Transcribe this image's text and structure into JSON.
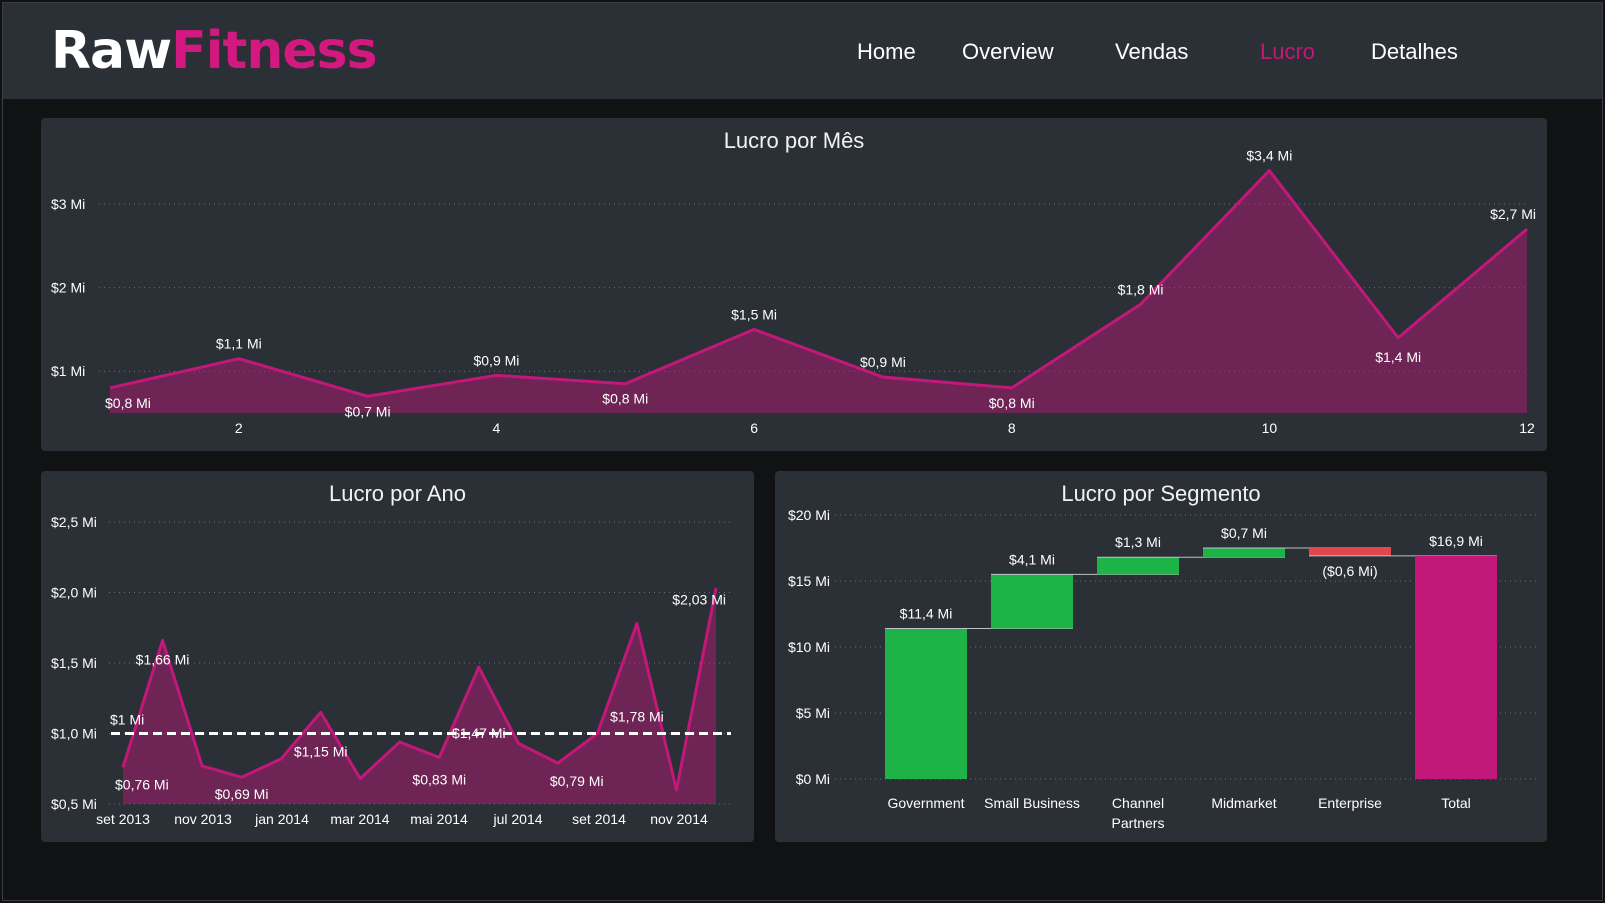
{
  "app": {
    "logo_part1": "Raw",
    "logo_part2": "Fitness",
    "colors": {
      "brand": "#d3187f",
      "increase": "#1db346",
      "decrease": "#e0474c",
      "total": "#c2187a",
      "panel": "#2b2f36",
      "background": "#111214"
    }
  },
  "nav": {
    "items": [
      {
        "label": "Home",
        "active": false
      },
      {
        "label": "Overview",
        "active": false
      },
      {
        "label": "Vendas",
        "active": false
      },
      {
        "label": "Lucro",
        "active": true
      },
      {
        "label": "Detalhes",
        "active": false
      }
    ]
  },
  "chart_data": [
    {
      "id": "monthly",
      "type": "area",
      "title": "Lucro por Mês",
      "x": [
        1,
        2,
        3,
        4,
        5,
        6,
        7,
        8,
        9,
        10,
        11,
        12
      ],
      "values": [
        0.8,
        1.15,
        0.7,
        0.95,
        0.85,
        1.5,
        0.93,
        0.8,
        1.8,
        3.4,
        1.4,
        2.7
      ],
      "labels": [
        "$0,8 Mi",
        "$1,1 Mi",
        "$0,7 Mi",
        "$0,9 Mi",
        "$0,8 Mi",
        "$1,5 Mi",
        "$0,9 Mi",
        "$0,8 Mi",
        "$1,8 Mi",
        "$3,4 Mi",
        "$1,4 Mi",
        "$2,7 Mi"
      ],
      "x_ticks": [
        "2",
        "4",
        "6",
        "8",
        "10",
        "12"
      ],
      "y_ticks": [
        "$1 Mi",
        "$2 Mi",
        "$3 Mi"
      ],
      "ylim": [
        0.5,
        3.5
      ],
      "grid": true,
      "color": "#c2187a"
    },
    {
      "id": "yearly",
      "type": "area",
      "title": "Lucro por Ano",
      "values": [
        0.76,
        1.66,
        0.77,
        0.69,
        0.82,
        1.15,
        0.68,
        0.94,
        0.83,
        1.47,
        0.93,
        0.79,
        1.0,
        1.78,
        0.6,
        2.03
      ],
      "point_labels": [
        {
          "index": 0,
          "text": "$0,76 Mi"
        },
        {
          "index": 1,
          "text": "$1,66 Mi"
        },
        {
          "index": 3,
          "text": "$0,69 Mi"
        },
        {
          "index": 5,
          "text": "$1,15 Mi"
        },
        {
          "index": 8,
          "text": "$0,83 Mi"
        },
        {
          "index": 9,
          "text": "$1,47 Mi"
        },
        {
          "index": 11,
          "text": "$0,79 Mi"
        },
        {
          "index": 13,
          "text": "$1,78 Mi"
        },
        {
          "index": 15,
          "text": "$2,03 Mi"
        }
      ],
      "x_ticks": [
        "set 2013",
        "nov 2013",
        "jan 2014",
        "mar 2014",
        "mai 2014",
        "jul 2014",
        "set 2014",
        "nov 2014"
      ],
      "y_ticks": [
        "$0,5 Mi",
        "$1,0 Mi",
        "$1,5 Mi",
        "$2,0 Mi",
        "$2,5 Mi"
      ],
      "ylim": [
        0.5,
        2.5
      ],
      "reference_line": {
        "value": 1.0,
        "label": "$1 Mi"
      },
      "grid": true,
      "color": "#c2187a"
    },
    {
      "id": "segment",
      "type": "bar",
      "subtype": "waterfall",
      "title": "Lucro por Segmento",
      "categories": [
        "Government",
        "Small Business",
        "Channel Partners",
        "Midmarket",
        "Enterprise",
        "Total"
      ],
      "category_lines": [
        [
          "Government"
        ],
        [
          "Small Business"
        ],
        [
          "Channel",
          "Partners"
        ],
        [
          "Midmarket"
        ],
        [
          "Enterprise"
        ],
        [
          "Total"
        ]
      ],
      "values": [
        11.4,
        4.1,
        1.3,
        0.7,
        -0.6,
        16.9
      ],
      "labels": [
        "$11,4 Mi",
        "$4,1 Mi",
        "$1,3 Mi",
        "$0,7 Mi",
        "($0,6 Mi)",
        "$16,9 Mi"
      ],
      "y_ticks": [
        "$0 Mi",
        "$5 Mi",
        "$10 Mi",
        "$15 Mi",
        "$20 Mi"
      ],
      "ylim": [
        0,
        20
      ],
      "grid": true
    }
  ]
}
